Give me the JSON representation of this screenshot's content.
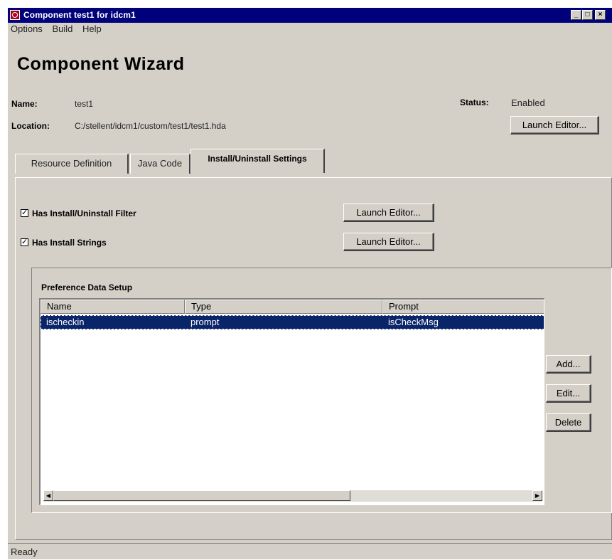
{
  "window": {
    "title": "Component test1 for idcm1",
    "controls": {
      "minimize": "_",
      "maximize": "□",
      "close": "×"
    }
  },
  "menu": {
    "items": [
      "Options",
      "Build",
      "Help"
    ]
  },
  "wizard": {
    "title": "Component Wizard"
  },
  "info": {
    "name_label": "Name:",
    "name_value": "test1",
    "location_label": "Location:",
    "location_value": "C:/stellent/idcm1/custom/test1/test1.hda",
    "status_label": "Status:",
    "status_value": "Enabled",
    "launch_editor_label": "Launch Editor..."
  },
  "tabs": [
    {
      "label": "Resource Definition",
      "active": false
    },
    {
      "label": "Java Code",
      "active": false
    },
    {
      "label": "Install/Uninstall Settings",
      "active": true
    }
  ],
  "settings": {
    "filter_label": "Has Install/Uninstall Filter",
    "filter_checked": true,
    "filter_button": "Launch Editor...",
    "strings_label": "Has Install Strings",
    "strings_checked": true,
    "strings_button": "Launch Editor..."
  },
  "preference": {
    "title": "Preference Data Setup",
    "columns": [
      "Name",
      "Type",
      "Prompt"
    ],
    "rows": [
      {
        "name": "ischeckin",
        "type": "prompt",
        "prompt": "isCheckMsg",
        "selected": true
      }
    ],
    "buttons": {
      "add": "Add...",
      "edit": "Edit...",
      "delete": "Delete"
    }
  },
  "status_bar": {
    "text": "Ready"
  },
  "icons": {
    "app": "app-icon",
    "scroll_left": "scroll-left-arrow-icon",
    "scroll_right": "scroll-right-arrow-icon"
  },
  "colors": {
    "titlebar": "#00007b",
    "selection": "#0a246a",
    "face": "#d4d0c8"
  }
}
